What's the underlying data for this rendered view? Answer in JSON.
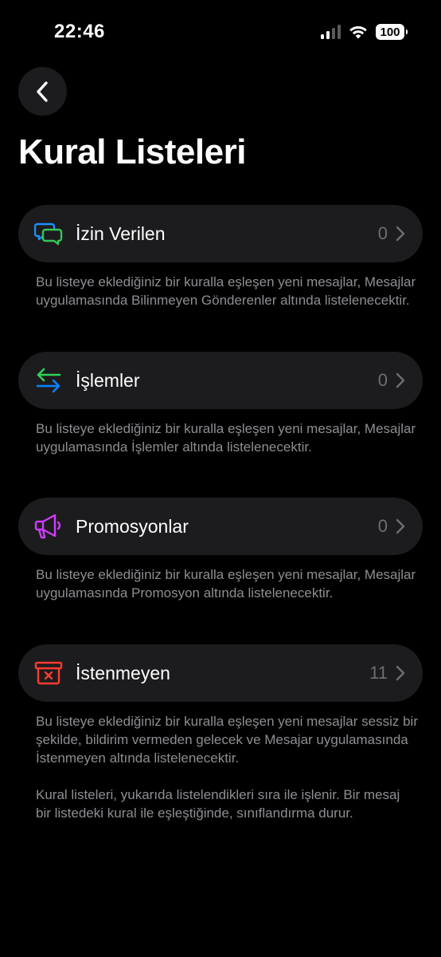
{
  "status_bar": {
    "time": "22:46",
    "battery": "100",
    "icons": [
      "signal-icon",
      "wifi-icon",
      "battery-icon"
    ]
  },
  "header": {
    "back_icon": "chevron-left-icon",
    "title": "Kural Listeleri"
  },
  "lists": [
    {
      "label": "İzin Verilen",
      "count": "0",
      "icon": "chat-bubbles-icon",
      "description": "Bu listeye eklediğiniz bir kuralla eşleşen yeni mesajlar, Mesajlar uygulamasında Bilinmeyen Gönderenler altında listelenecektir."
    },
    {
      "label": "İşlemler",
      "count": "0",
      "icon": "arrows-left-right-icon",
      "description": "Bu listeye eklediğiniz bir kuralla eşleşen yeni mesajlar, Mesajlar uygulamasında İşlemler altında listelenecektir."
    },
    {
      "label": "Promosyonlar",
      "count": "0",
      "icon": "megaphone-icon",
      "description": "Bu listeye eklediğiniz bir kuralla eşleşen yeni mesajlar, Mesajlar uygulamasında Promosyon altında listelenecektir."
    },
    {
      "label": "İstenmeyen",
      "count": "11",
      "icon": "junk-tray-icon",
      "description": "Bu listeye eklediğiniz bir kuralla eşleşen yeni mesajlar sessiz bir şekilde, bildirim vermeden gelecek ve Mesajar uygulamasında İstenmeyen altında listelenecektir."
    }
  ],
  "footer_note": "Kural listeleri, yukarıda listelendikleri sıra ile işlenir. Bir mesaj bir listedeki kural ile eşleştiğinde, sınıflandırma durur.",
  "colors": {
    "background": "#000000",
    "row_background": "#1c1c1e",
    "secondary_text": "#8e8e93",
    "allowed_icon_blue": "#1e90ff",
    "allowed_icon_green": "#34c759",
    "transactions_green": "#30d158",
    "transactions_blue": "#0a84ff",
    "promotions_purple": "#d13bff",
    "junk_red": "#ff3b30"
  }
}
